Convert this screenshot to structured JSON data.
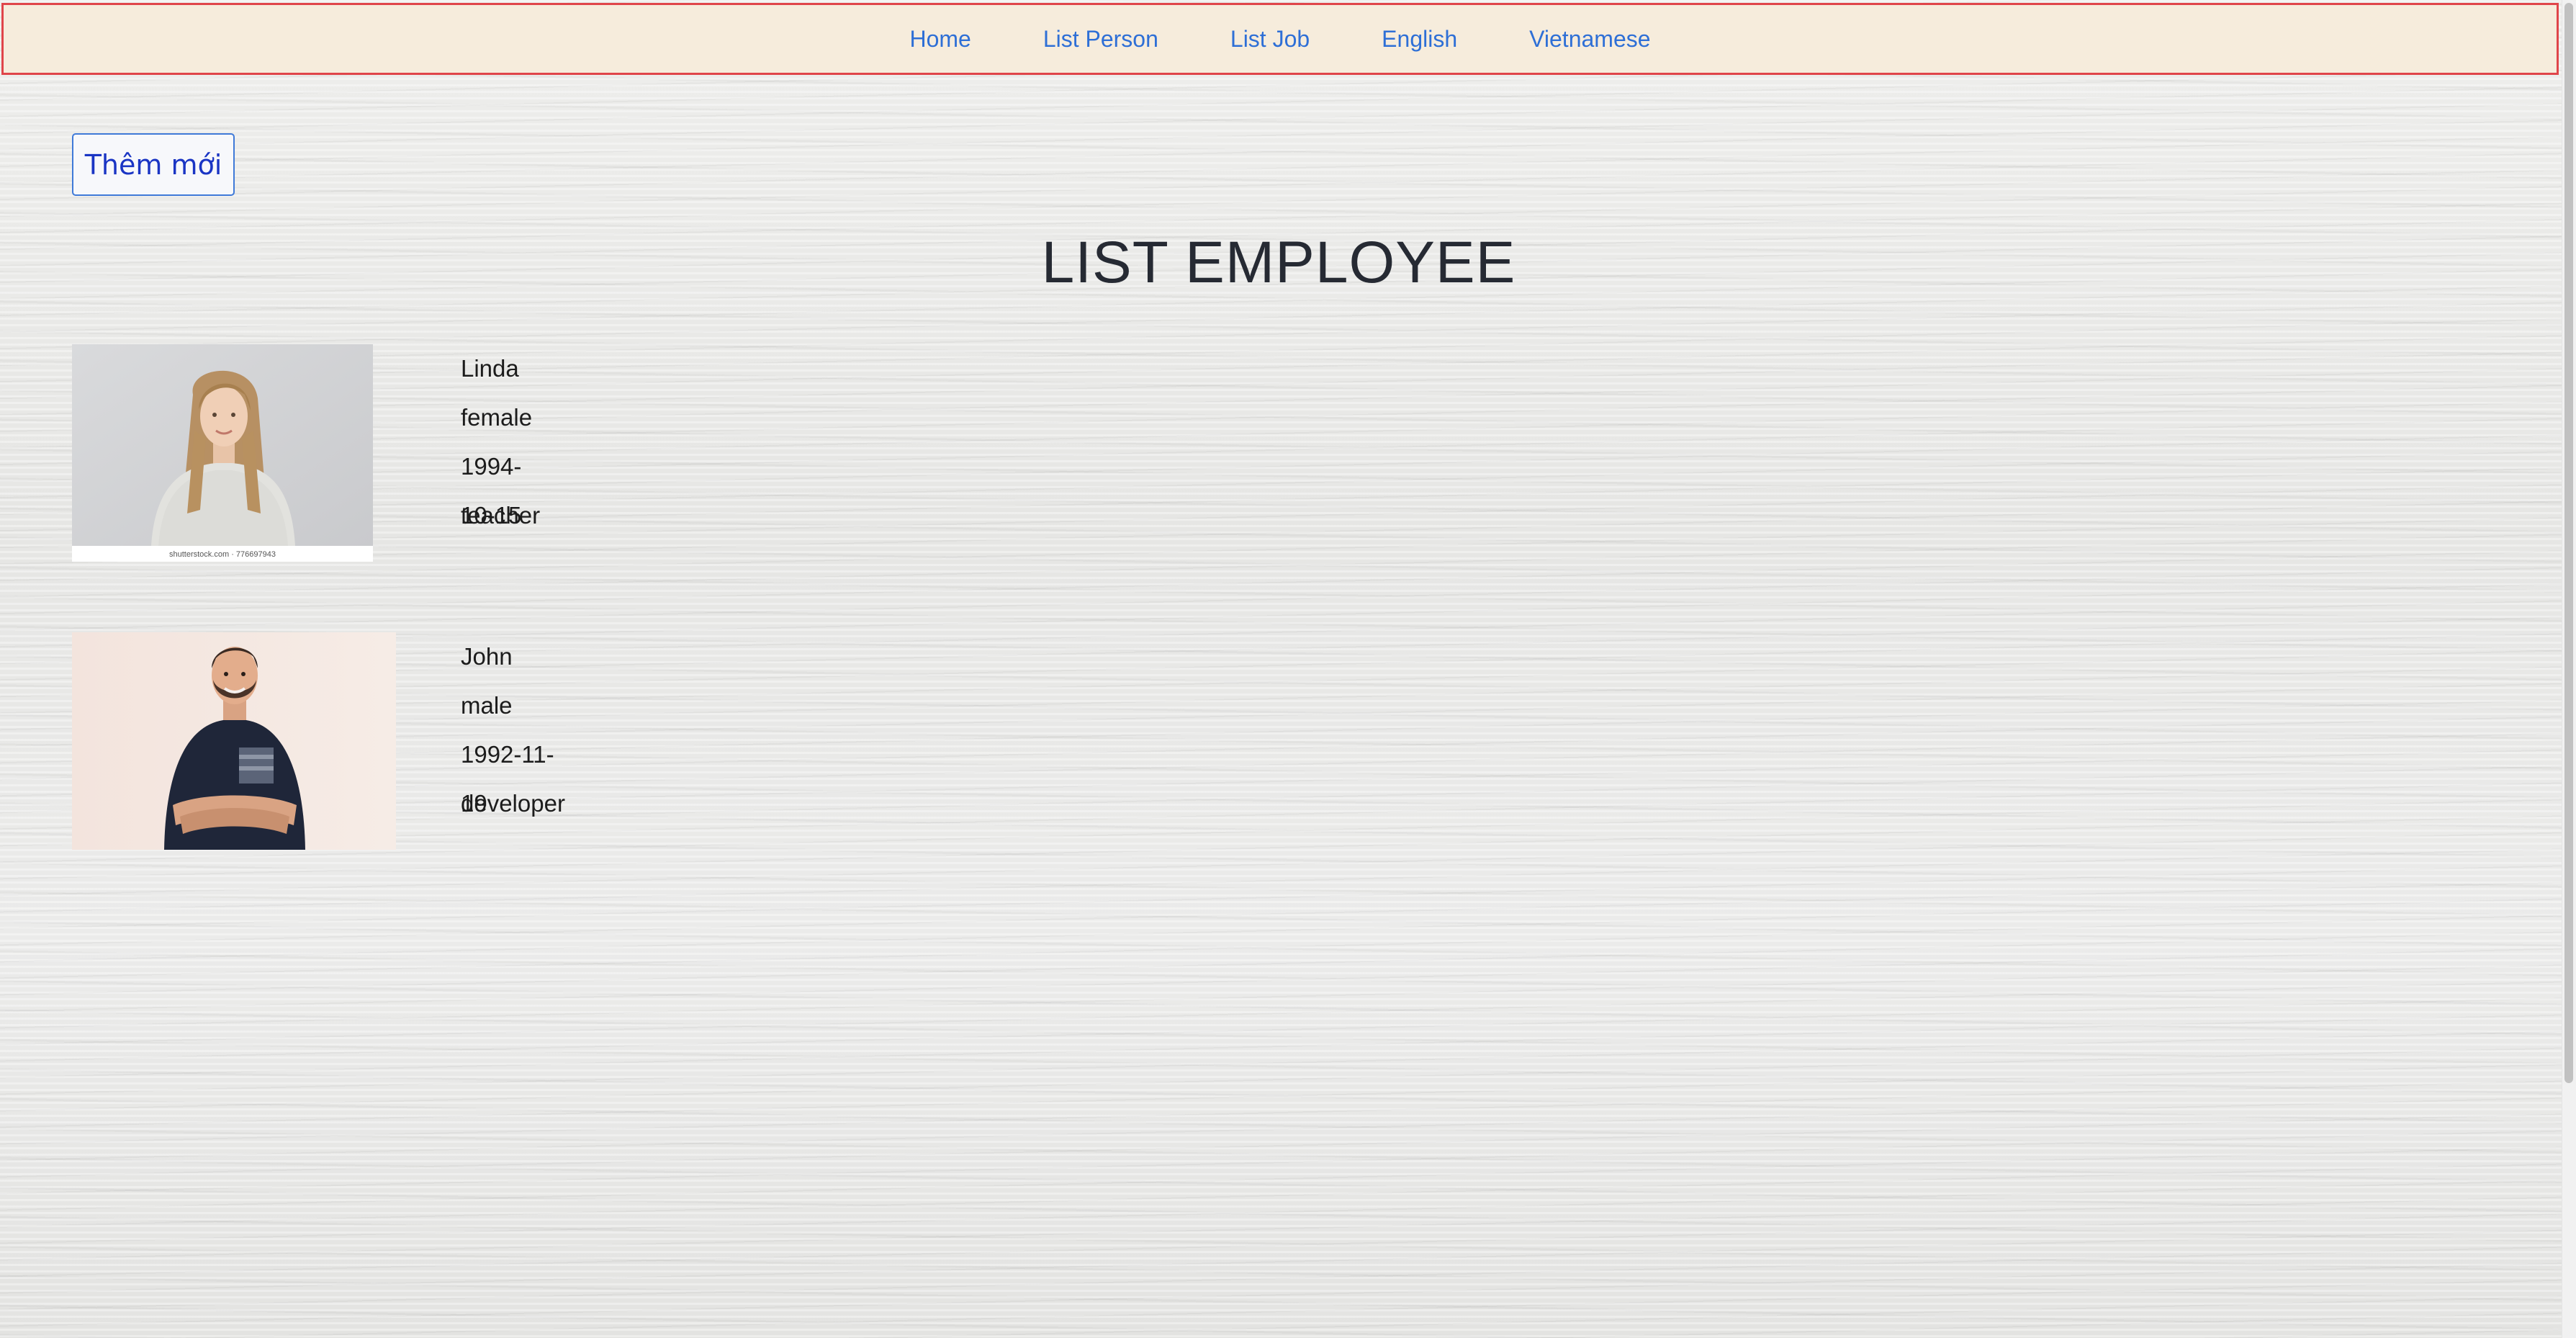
{
  "nav": {
    "items": [
      {
        "label": "Home"
      },
      {
        "label": "List Person"
      },
      {
        "label": "List Job"
      },
      {
        "label": "English"
      },
      {
        "label": "Vietnamese"
      }
    ],
    "link_color": "#2e6fd6",
    "background": "#f6ecdc",
    "border_color": "#e0454a"
  },
  "add_button": {
    "label": "Thêm mới"
  },
  "page_title": "LIST EMPLOYEE",
  "employees": [
    {
      "name": "Linda",
      "gender": "female",
      "birthdate": "1994-10-15",
      "job": "teacher",
      "photo_caption": "shutterstock.com · 776697943"
    },
    {
      "name": "John",
      "gender": "male",
      "birthdate": "1992-11-19",
      "job": "developer"
    }
  ]
}
